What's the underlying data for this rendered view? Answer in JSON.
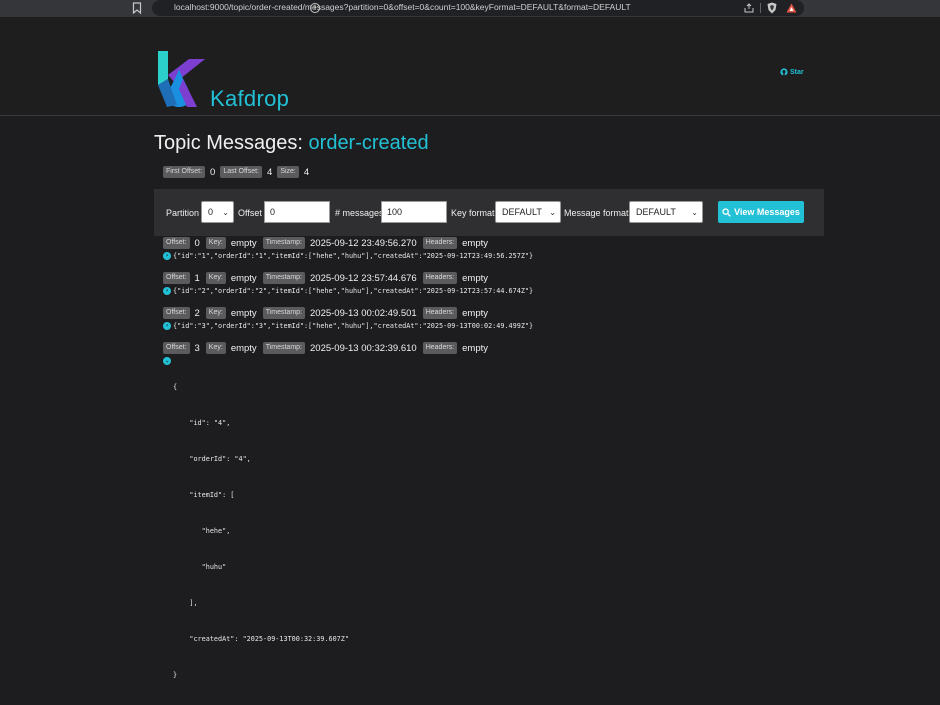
{
  "browser": {
    "url": "localhost:9000/topic/order-created/messages?partition=0&offset=0&count=100&keyFormat=DEFAULT&format=DEFAULT"
  },
  "header": {
    "brand": "Kafdrop",
    "star_label": "Star",
    "accent_color": "#22c1d6"
  },
  "page": {
    "title_prefix": "Topic Messages:",
    "topic_name": "order-created"
  },
  "stats": {
    "first_offset_label": "First Offset:",
    "first_offset": "0",
    "last_offset_label": "Last Offset:",
    "last_offset": "4",
    "size_label": "Size:",
    "size": "4"
  },
  "filter": {
    "partition_label": "Partition",
    "partition_value": "0",
    "offset_label": "Offset",
    "offset_value": "0",
    "count_label": "# messages",
    "count_value": "100",
    "key_format_label": "Key format",
    "key_format_value": "DEFAULT",
    "message_format_label": "Message format",
    "message_format_value": "DEFAULT",
    "view_button": "View Messages"
  },
  "labels": {
    "offset": "Offset:",
    "key": "Key:",
    "timestamp": "Timestamp:",
    "headers": "Headers:"
  },
  "messages": [
    {
      "offset": "0",
      "key": "empty",
      "timestamp": "2025-09-12 23:49:56.270",
      "headers": "empty",
      "body": "{\"id\":\"1\",\"orderId\":\"1\",\"itemId\":[\"hehe\",\"huhu\"],\"createdAt\":\"2025-09-12T23:49:56.257Z\"}"
    },
    {
      "offset": "1",
      "key": "empty",
      "timestamp": "2025-09-12 23:57:44.676",
      "headers": "empty",
      "body": "{\"id\":\"2\",\"orderId\":\"2\",\"itemId\":[\"hehe\",\"huhu\"],\"createdAt\":\"2025-09-12T23:57:44.674Z\"}"
    },
    {
      "offset": "2",
      "key": "empty",
      "timestamp": "2025-09-13 00:02:49.501",
      "headers": "empty",
      "body": "{\"id\":\"3\",\"orderId\":\"3\",\"itemId\":[\"hehe\",\"huhu\"],\"createdAt\":\"2025-09-13T00:02:49.499Z\"}"
    },
    {
      "offset": "3",
      "key": "empty",
      "timestamp": "2025-09-13 00:32:39.610",
      "headers": "empty",
      "body_lines": [
        "{",
        "    \"id\": \"4\",",
        "    \"orderId\": \"4\",",
        "    \"itemId\": [",
        "       \"hehe\",",
        "       \"huhu\"",
        "    ],",
        "    \"createdAt\": \"2025-09-13T00:32:39.607Z\"",
        "}"
      ]
    }
  ]
}
